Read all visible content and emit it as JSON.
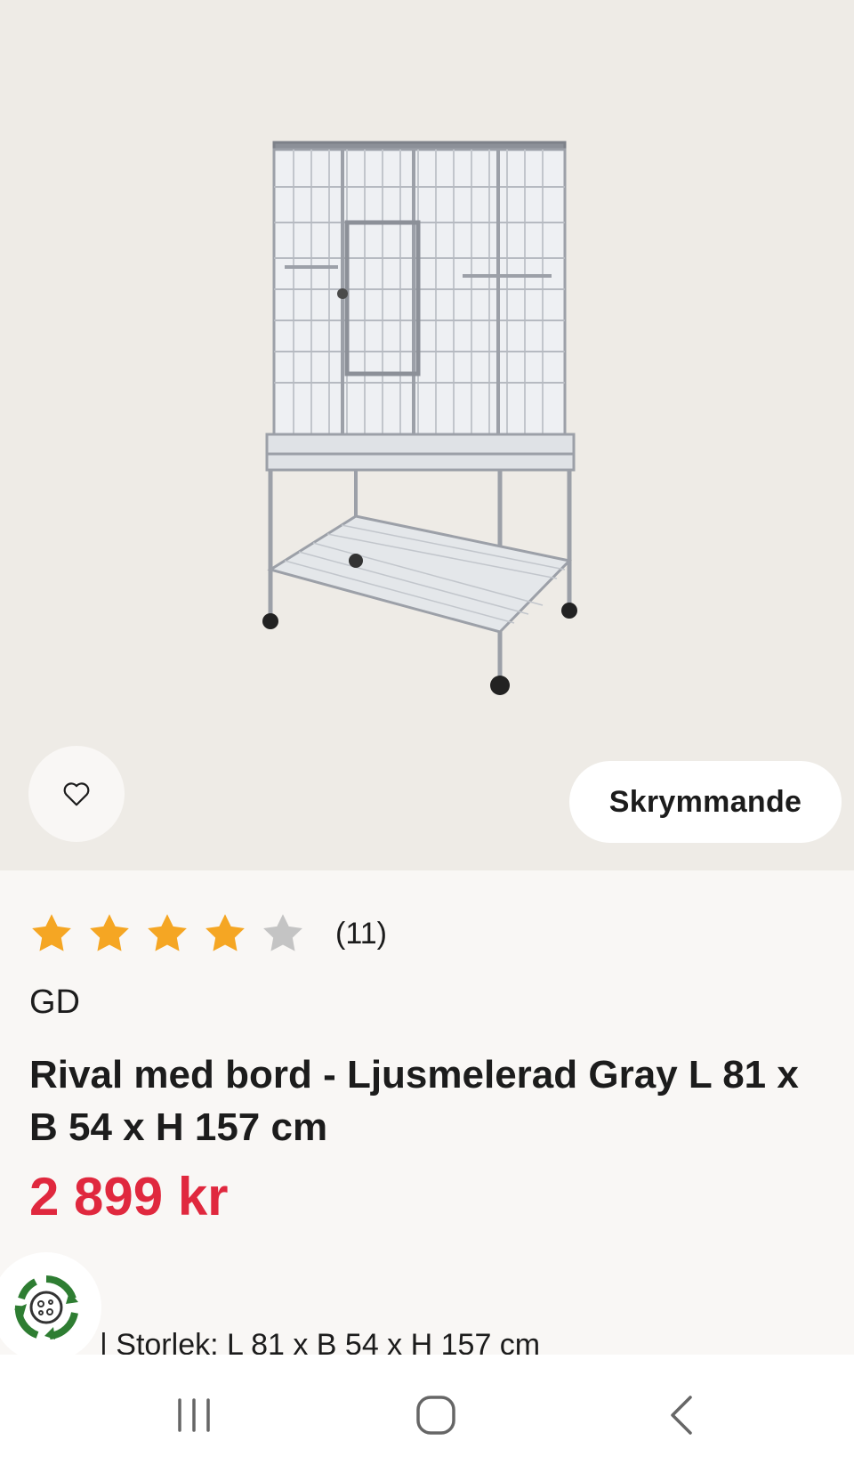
{
  "product": {
    "image_alt": "Bird cage on stand with wheels",
    "favorite_icon": "heart-outline-icon",
    "badge": "Skrymmande",
    "rating": {
      "value": 4,
      "max": 5,
      "count_label": "(11)"
    },
    "brand": "GD",
    "title": "Rival med bord - Ljusmelerad Gray L 81 x B 54 x H 157 cm",
    "price": "2 899 kr",
    "size_line": "| Storlek: L 81 x B 54 x H 157 cm"
  },
  "eco_icon": "recycle-globe-icon",
  "navbar": {
    "recent_icon": "recent-apps-icon",
    "home_icon": "home-icon",
    "back_icon": "back-icon"
  },
  "colors": {
    "price": "#e0283e",
    "star_filled": "#f5a623",
    "star_empty": "#c4c4c4",
    "eco_green": "#2e7d32"
  }
}
